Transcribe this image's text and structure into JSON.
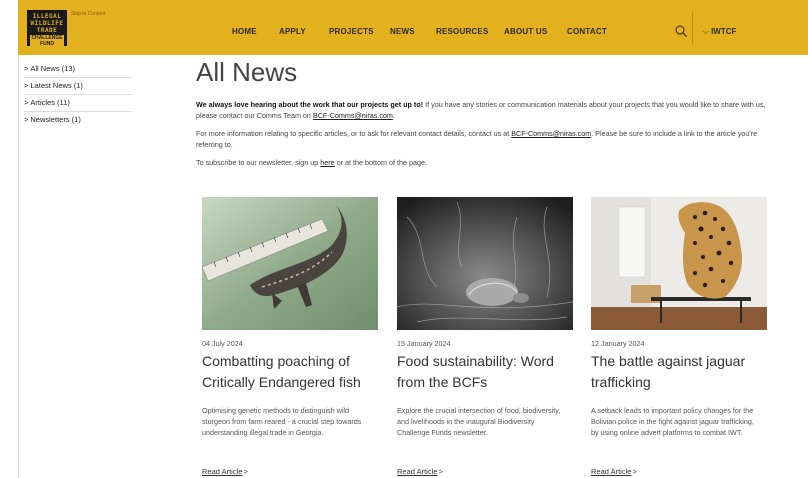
{
  "header": {
    "logo_lines": [
      "ILLEGAL",
      "WILDLIFE",
      "TRADE"
    ],
    "logo_fund_lines": [
      "CHALLENGE",
      "FUND"
    ],
    "small_link": "Skip to Content",
    "nav": [
      "HOME",
      "APPLY",
      "PROJECTS",
      "NEWS",
      "RESOURCES",
      "ABOUT US",
      "CONTACT"
    ],
    "dropdown_label": "IWTCF",
    "search_icon": "search-icon",
    "accent_color": "#e3b11d"
  },
  "sidebar": {
    "items": [
      {
        "label": "All News (13)"
      },
      {
        "label": "Latest News (1)"
      },
      {
        "label": "Articles (11)"
      },
      {
        "label": "Newsletters (1)"
      }
    ]
  },
  "main": {
    "title": "All News",
    "intro_bold": "We always love hearing about the work that our projects get up to!",
    "intro_1": " If you have any stories or communication materials about your projects that you would like to share with us, please contact our Comms Team on ",
    "email": "BCF-Comms@niras.com",
    "intro_1_end": ".",
    "intro_2": "For more information relating to specific articles, or to ask for relevant contact details, contact us at ",
    "intro_2_end": ". Please be sure to include a link to the article you're referring to.",
    "intro_3": "To subscribe to our newsletter, sign up ",
    "here": "here",
    "intro_3_end": " or at the bottom of the page."
  },
  "articles": [
    {
      "date": "04 July 2024",
      "title": "Combatting poaching of Critically Endangered fish",
      "desc": "Optimising genetic methods to distinguish wild sturgeon from farm reared - a crucial step towards understanding illegal trade in Georgia.",
      "read": "Read Article"
    },
    {
      "date": "15 January 2024",
      "title": "Food sustainability: Word from the BCFs",
      "desc": "Explore the crucial intersection of food, biodiversity, and livelihoods in the inaugural Biodiversity Challenge Funds newsletter.",
      "read": "Read Article"
    },
    {
      "date": "12 January 2024",
      "title": "The battle against jaguar trafficking",
      "desc": "A setback leads to important policy changes for the Bolivian police in the fight against jaguar trafficking, by using online advert platforms to combat IWT.",
      "read": "Read Article"
    }
  ]
}
